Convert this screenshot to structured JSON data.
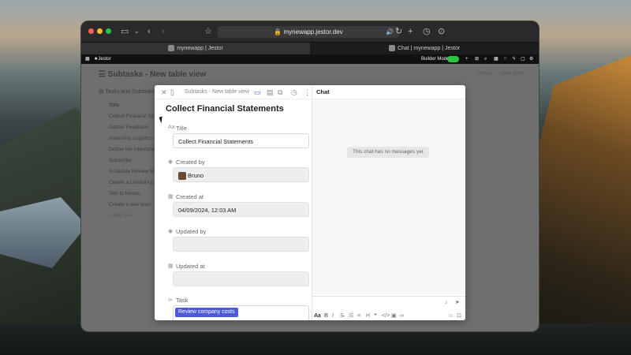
{
  "browser": {
    "url": "mynewapp.jestor.dev",
    "tabs": [
      "mynewapp | Jestor",
      "Chat | mynewapp | Jestor"
    ],
    "traffic_lights": [
      "#ff5f57",
      "#febc2e",
      "#28c840"
    ]
  },
  "appbar": {
    "brand": "Jestor",
    "builder_mode_label": "Builder Mode",
    "builder_mode_on": true
  },
  "background_page": {
    "title": "Subtasks - New table view",
    "sidebar_heading": "Tasks and Subtasks",
    "column_header": "Title",
    "rows": [
      "Collect Financial Sta",
      "Gather Feedback",
      "Internship Logistics",
      "Define the Internship",
      "Subscribe",
      "Schedule Review M",
      "Create a Linkedin p",
      "Talk to friends",
      "Create a new plan"
    ],
    "add_row": "Add row",
    "views_label": "Views",
    "new_item_label": "New item"
  },
  "record": {
    "breadcrumb": "Subtasks - New table view",
    "title": "Collect Financial Statements",
    "fields": [
      {
        "label": "Title",
        "value": "Collect Financial Statements"
      },
      {
        "label": "Created by",
        "value": "Bruno"
      },
      {
        "label": "Created at",
        "value": "04/09/2024, 12:03 AM"
      },
      {
        "label": "Updated by",
        "value": ""
      },
      {
        "label": "Updated at",
        "value": ""
      },
      {
        "label": "Task",
        "value": "Review company costs"
      }
    ]
  },
  "chat": {
    "title": "Chat",
    "empty_message": "This chat has no messages yet",
    "format_label": "Aa"
  },
  "colors": {
    "accent": "#4c5ad6",
    "toggle_green": "#28c840"
  }
}
